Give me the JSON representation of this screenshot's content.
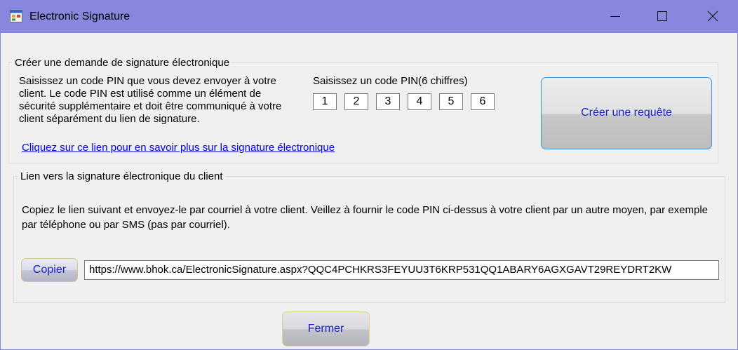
{
  "window": {
    "title": "Electronic Signature",
    "icon": "app-window-icon",
    "controls": {
      "minimize": "minimize-icon",
      "maximize": "maximize-icon",
      "close": "close-icon"
    }
  },
  "request_group": {
    "legend": "Créer une demande de signature électronique",
    "description": "Saisissez un code PIN que vous devez envoyer à votre client. Le code PIN est utilisé comme un élément de sécurité supplémentaire et doit être communiqué à votre client séparément du lien de signature.",
    "learn_more_link": "Cliquez sur ce lien pour en savoir plus sur la signature électronique",
    "pin_label": "Saisissez un code PIN(6 chiffres)",
    "pin_digits": [
      "1",
      "2",
      "3",
      "4",
      "5",
      "6"
    ],
    "create_button": "Créer une requête"
  },
  "link_group": {
    "legend": "Lien vers la signature électronique du client",
    "instructions": "Copiez le lien suivant et envoyez-le par courriel à votre client. Veillez à fournir le code PIN ci-dessus à votre client par un autre moyen, par exemple par téléphone ou par SMS (pas par courriel).",
    "copy_button": "Copier",
    "signature_url": "https://www.bhok.ca/ElectronicSignature.aspx?QQC4PCHKRS3FEYUU3T6KRP531QQ1ABARY6AGXGAVT29REYDRT2KW"
  },
  "footer": {
    "close_button": "Fermer"
  },
  "colors": {
    "titlebar": "#8787dd",
    "client_bg": "#f0f0f0",
    "button_text": "#1a24c2",
    "link": "#0000ee"
  }
}
